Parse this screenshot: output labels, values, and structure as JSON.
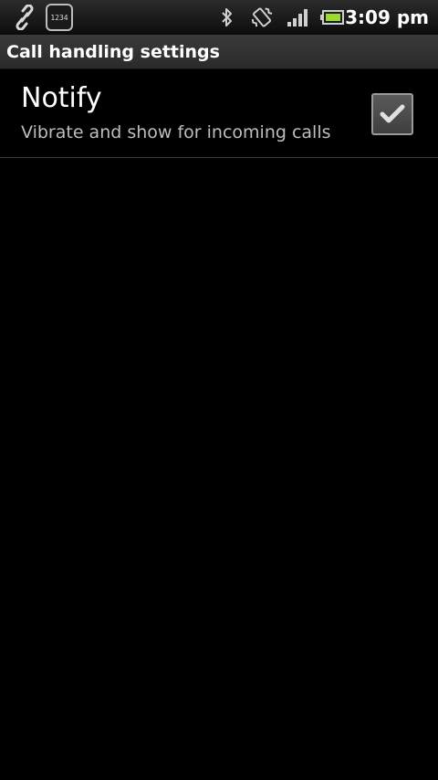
{
  "status_bar": {
    "icons": [
      "link-icon",
      "counter-widget-icon",
      "bluetooth-icon",
      "vibrate-icon",
      "signal-icon",
      "battery-icon"
    ],
    "counter_text": "1234",
    "time": "3:09 pm"
  },
  "header": {
    "title": "Call handling settings"
  },
  "preferences": [
    {
      "title": "Notify",
      "summary": "Vibrate and show for incoming calls",
      "checked": true
    }
  ],
  "colors": {
    "background": "#000000",
    "title_bar": "#333333",
    "summary_text": "#bdbdbd",
    "divider": "#3d3d3d"
  }
}
